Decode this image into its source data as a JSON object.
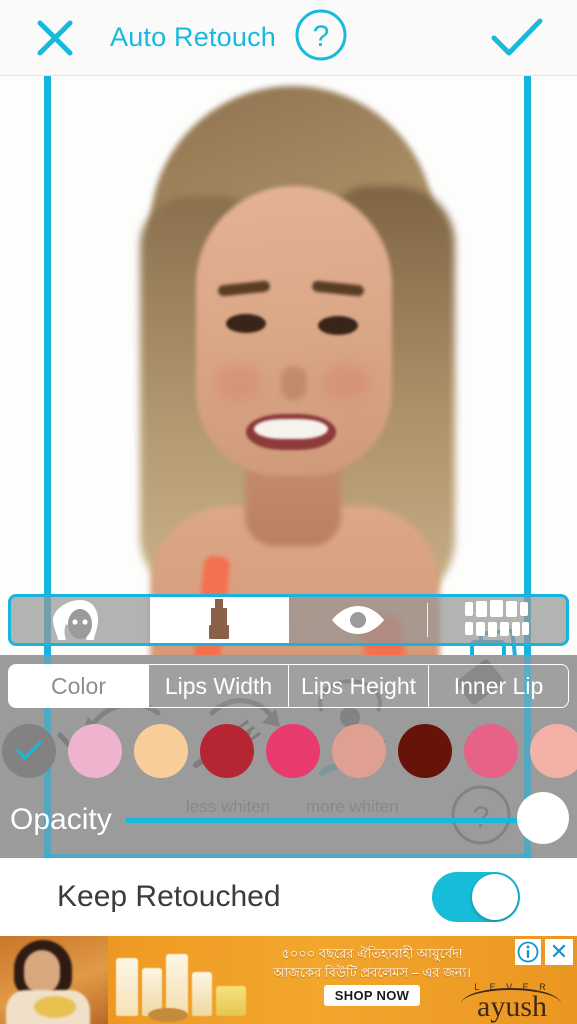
{
  "header": {
    "title": "Auto Retouch",
    "close_icon": "close-x-icon",
    "help_icon": "help-question-icon",
    "done_icon": "checkmark-icon",
    "accent_color": "#17b9dd"
  },
  "toolbar": {
    "items": [
      {
        "name": "face",
        "icon": "face-woman-icon",
        "selected": false
      },
      {
        "name": "lips",
        "icon": "lipstick-icon",
        "selected": true
      },
      {
        "name": "eyes",
        "icon": "eye-icon",
        "selected": false
      },
      {
        "name": "teeth",
        "icon": "teeth-icon",
        "selected": false
      }
    ],
    "overlay_icon": "copy-layers-icon"
  },
  "tabs": [
    {
      "label": "Color",
      "active": true
    },
    {
      "label": "Lips Width",
      "active": false
    },
    {
      "label": "Lips Height",
      "active": false
    },
    {
      "label": "Inner Lip",
      "active": false
    }
  ],
  "swatches": {
    "none_swatch": {
      "color": "#828282",
      "selected": true,
      "check_icon": "check-icon",
      "check_color": "#17b9dd"
    },
    "colors": [
      "#f0b3ce",
      "#f8cd9a",
      "#b62632",
      "#e93a6d",
      "#dfa093",
      "#661309",
      "#e66287",
      "#f4b2a7",
      "#ea1c24",
      "#ed5f63"
    ]
  },
  "opacity": {
    "label": "Opacity",
    "value": 100,
    "track_color": "#17b9dd",
    "knob_color": "#ffffff"
  },
  "ghost_overlay": {
    "less_label": "less whiten",
    "more_label": "more whiten",
    "help_glyph": "?",
    "icons": [
      "undo-arrow-icon",
      "redo-arrow-icon",
      "rotate-icon",
      "eraser-icon",
      "toothbrush-icon"
    ]
  },
  "keep_retouched": {
    "label": "Keep Retouched",
    "enabled": true,
    "on_color": "#17bcd8"
  },
  "ad": {
    "line1": "৫০০০ বছরের ঐতিহ্যবাহী আয়ুর্বেদ!",
    "line2": "আজকের বিউটি প্রবলেমস – এর জন্য।",
    "cta": "SHOP NOW",
    "brand_top": "L E V E R",
    "brand": "ayush",
    "info_glyph": "i",
    "close_glyph": "✕",
    "bg_color": "#ef9c25"
  }
}
